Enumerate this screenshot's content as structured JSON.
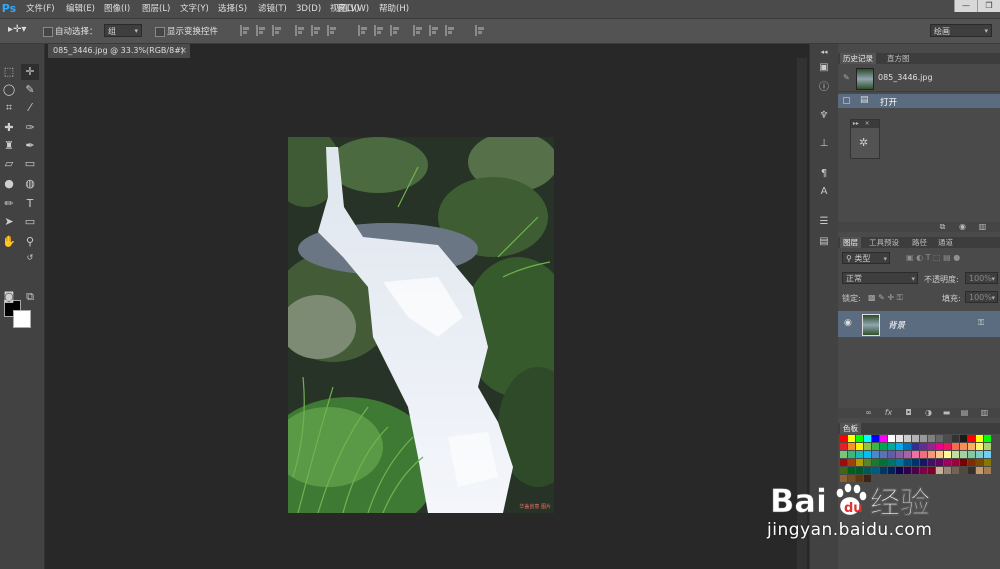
{
  "app": {
    "logo": "Ps"
  },
  "menu": [
    "文件(F)",
    "编辑(E)",
    "图像(I)",
    "图层(L)",
    "文字(Y)",
    "选择(S)",
    "滤镜(T)",
    "3D(D)",
    "视图(V)",
    "窗口(W)",
    "帮助(H)"
  ],
  "window_controls": {
    "minimize": "—",
    "restore": "❐"
  },
  "options": {
    "auto_select_label": "自动选择：",
    "auto_select_value": "组",
    "show_transform_label": "显示变换控件",
    "workspace": "绘画"
  },
  "document": {
    "tab_title": "085_3446.jpg @ 33.3%(RGB/8#)",
    "close": "×"
  },
  "history_panel": {
    "tabs": [
      "历史记录",
      "直方图"
    ],
    "snapshot_name": "085_3446.jpg",
    "states": [
      "打开"
    ]
  },
  "layers_panel": {
    "tabs": [
      "图层",
      "工具预设",
      "路径",
      "通道"
    ],
    "filter_kind": "类型",
    "blend_mode": "正常",
    "opacity_label": "不透明度:",
    "opacity_value": "100%",
    "lock_label": "锁定:",
    "fill_label": "填充:",
    "fill_value": "100%",
    "layers": [
      {
        "name": "背景",
        "visible": true,
        "locked": true
      }
    ]
  },
  "swatches_panel": {
    "tab": "色板"
  },
  "watermark": {
    "brand_text": "Bai经验",
    "site": "jingyan.baidu.com"
  },
  "photo_watermark": "华盖创意 图片",
  "colors": {
    "history_selected": "#5c6c80",
    "menu_bg": "#4b4b4b",
    "canvas_bg": "#282828",
    "ps_blue": "#31a8ff"
  }
}
